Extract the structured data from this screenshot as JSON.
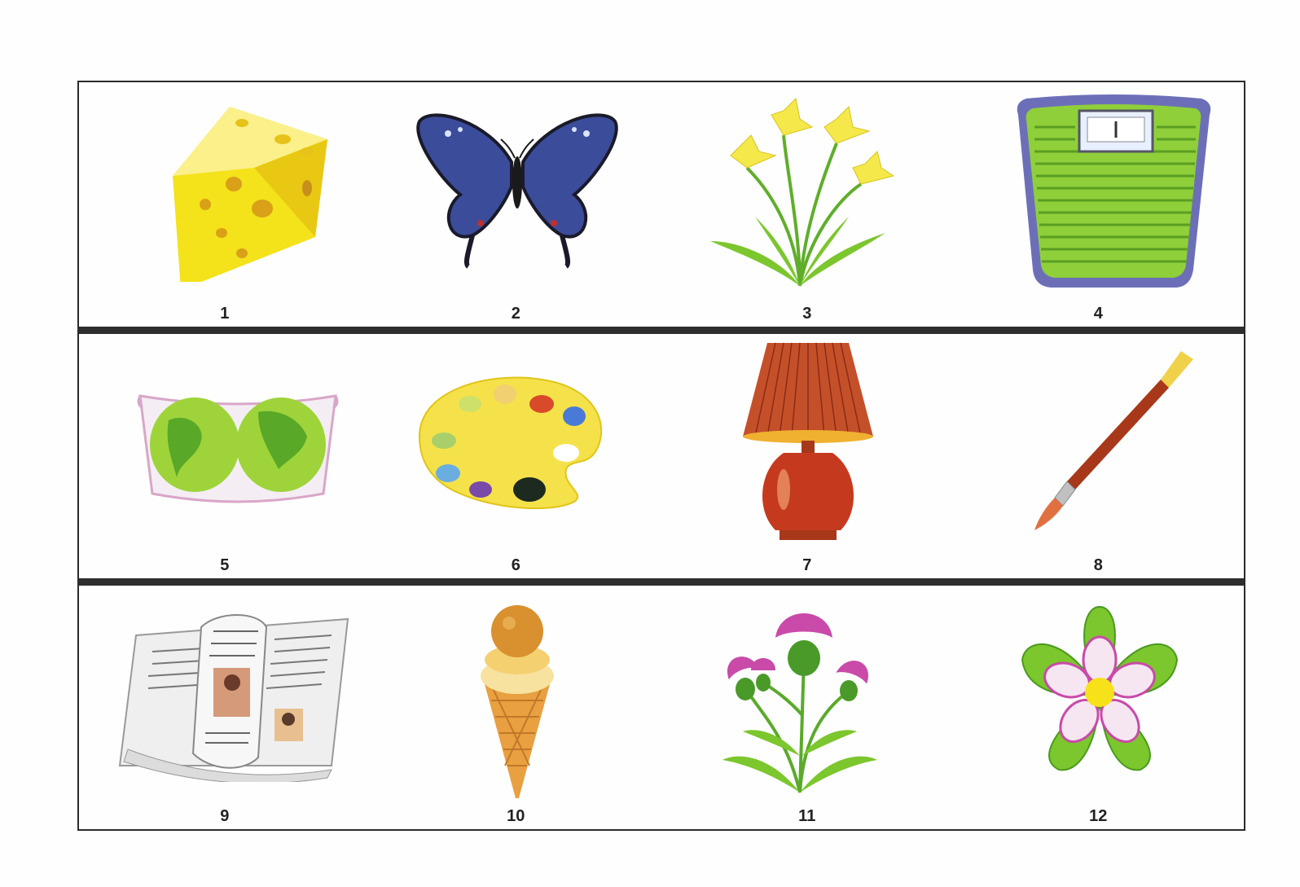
{
  "items": [
    {
      "number": "1",
      "icon": "cheese-icon"
    },
    {
      "number": "2",
      "icon": "butterfly-icon"
    },
    {
      "number": "3",
      "icon": "daffodil-icon"
    },
    {
      "number": "4",
      "icon": "bathroom-scale-icon"
    },
    {
      "number": "5",
      "icon": "world-map-icon"
    },
    {
      "number": "6",
      "icon": "paint-palette-icon"
    },
    {
      "number": "7",
      "icon": "table-lamp-icon"
    },
    {
      "number": "8",
      "icon": "paintbrush-icon"
    },
    {
      "number": "9",
      "icon": "newspaper-icon"
    },
    {
      "number": "10",
      "icon": "ice-cream-cone-icon"
    },
    {
      "number": "11",
      "icon": "thistle-icon"
    },
    {
      "number": "12",
      "icon": "pink-flower-icon"
    }
  ],
  "colors": {
    "border": "#2b2b2b",
    "cheese": "#f4e21a",
    "butterfly": "#3b4c9a",
    "daffodil": "#f5e84a",
    "scale": "#8fcf3a",
    "lamp": "#c53a1e",
    "thistle": "#c94aa8",
    "leaf": "#7cc62e"
  }
}
